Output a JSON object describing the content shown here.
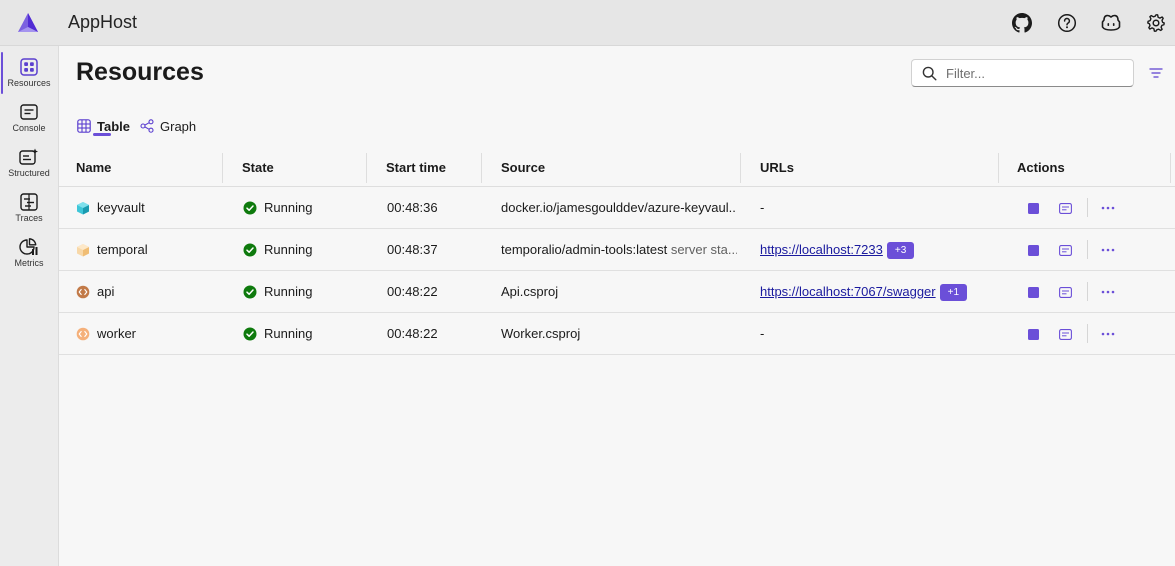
{
  "header": {
    "app_title": "AppHost",
    "icons": [
      "github-icon",
      "help-icon",
      "copilot-icon",
      "settings-icon"
    ],
    "accent": "#6b4fd8"
  },
  "sidebar": {
    "items": [
      {
        "label": "Resources",
        "icon": "resources-icon",
        "active": true
      },
      {
        "label": "Console",
        "icon": "console-icon"
      },
      {
        "label": "Structured",
        "icon": "structured-logs-icon"
      },
      {
        "label": "Traces",
        "icon": "traces-icon"
      },
      {
        "label": "Metrics",
        "icon": "metrics-icon"
      }
    ]
  },
  "main": {
    "title": "Resources",
    "filter_placeholder": "Filter...",
    "tabs": [
      {
        "label": "Table",
        "active": true
      },
      {
        "label": "Graph"
      }
    ]
  },
  "table": {
    "columns": [
      "Name",
      "State",
      "Start time",
      "Source",
      "URLs",
      "Actions"
    ],
    "rows": [
      {
        "name": "keyvault",
        "icon": "cube-icon",
        "icon_color": "#20b2c8",
        "state": "Running",
        "start": "00:48:36",
        "source": "docker.io/jamesgoulddev/azure-keyvaul...",
        "source_extra": "",
        "url": "-",
        "url_is_link": false,
        "badge": ""
      },
      {
        "name": "temporal",
        "icon": "cube-icon",
        "icon_color": "#f5c887",
        "state": "Running",
        "start": "00:48:37",
        "source": "temporalio/admin-tools:latest",
        "source_extra": "server sta...",
        "url": "https://localhost:7233",
        "url_is_link": true,
        "badge": "+3"
      },
      {
        "name": "api",
        "icon": "project-icon",
        "icon_color": "#b06a3a",
        "state": "Running",
        "start": "00:48:22",
        "source": "Api.csproj",
        "source_extra": "",
        "url": "https://localhost:7067/swagger",
        "url_is_link": true,
        "badge": "+1"
      },
      {
        "name": "worker",
        "icon": "project-icon",
        "icon_color": "#f0a66c",
        "state": "Running",
        "start": "00:48:22",
        "source": "Worker.csproj",
        "source_extra": "",
        "url": "-",
        "url_is_link": false,
        "badge": ""
      }
    ]
  }
}
